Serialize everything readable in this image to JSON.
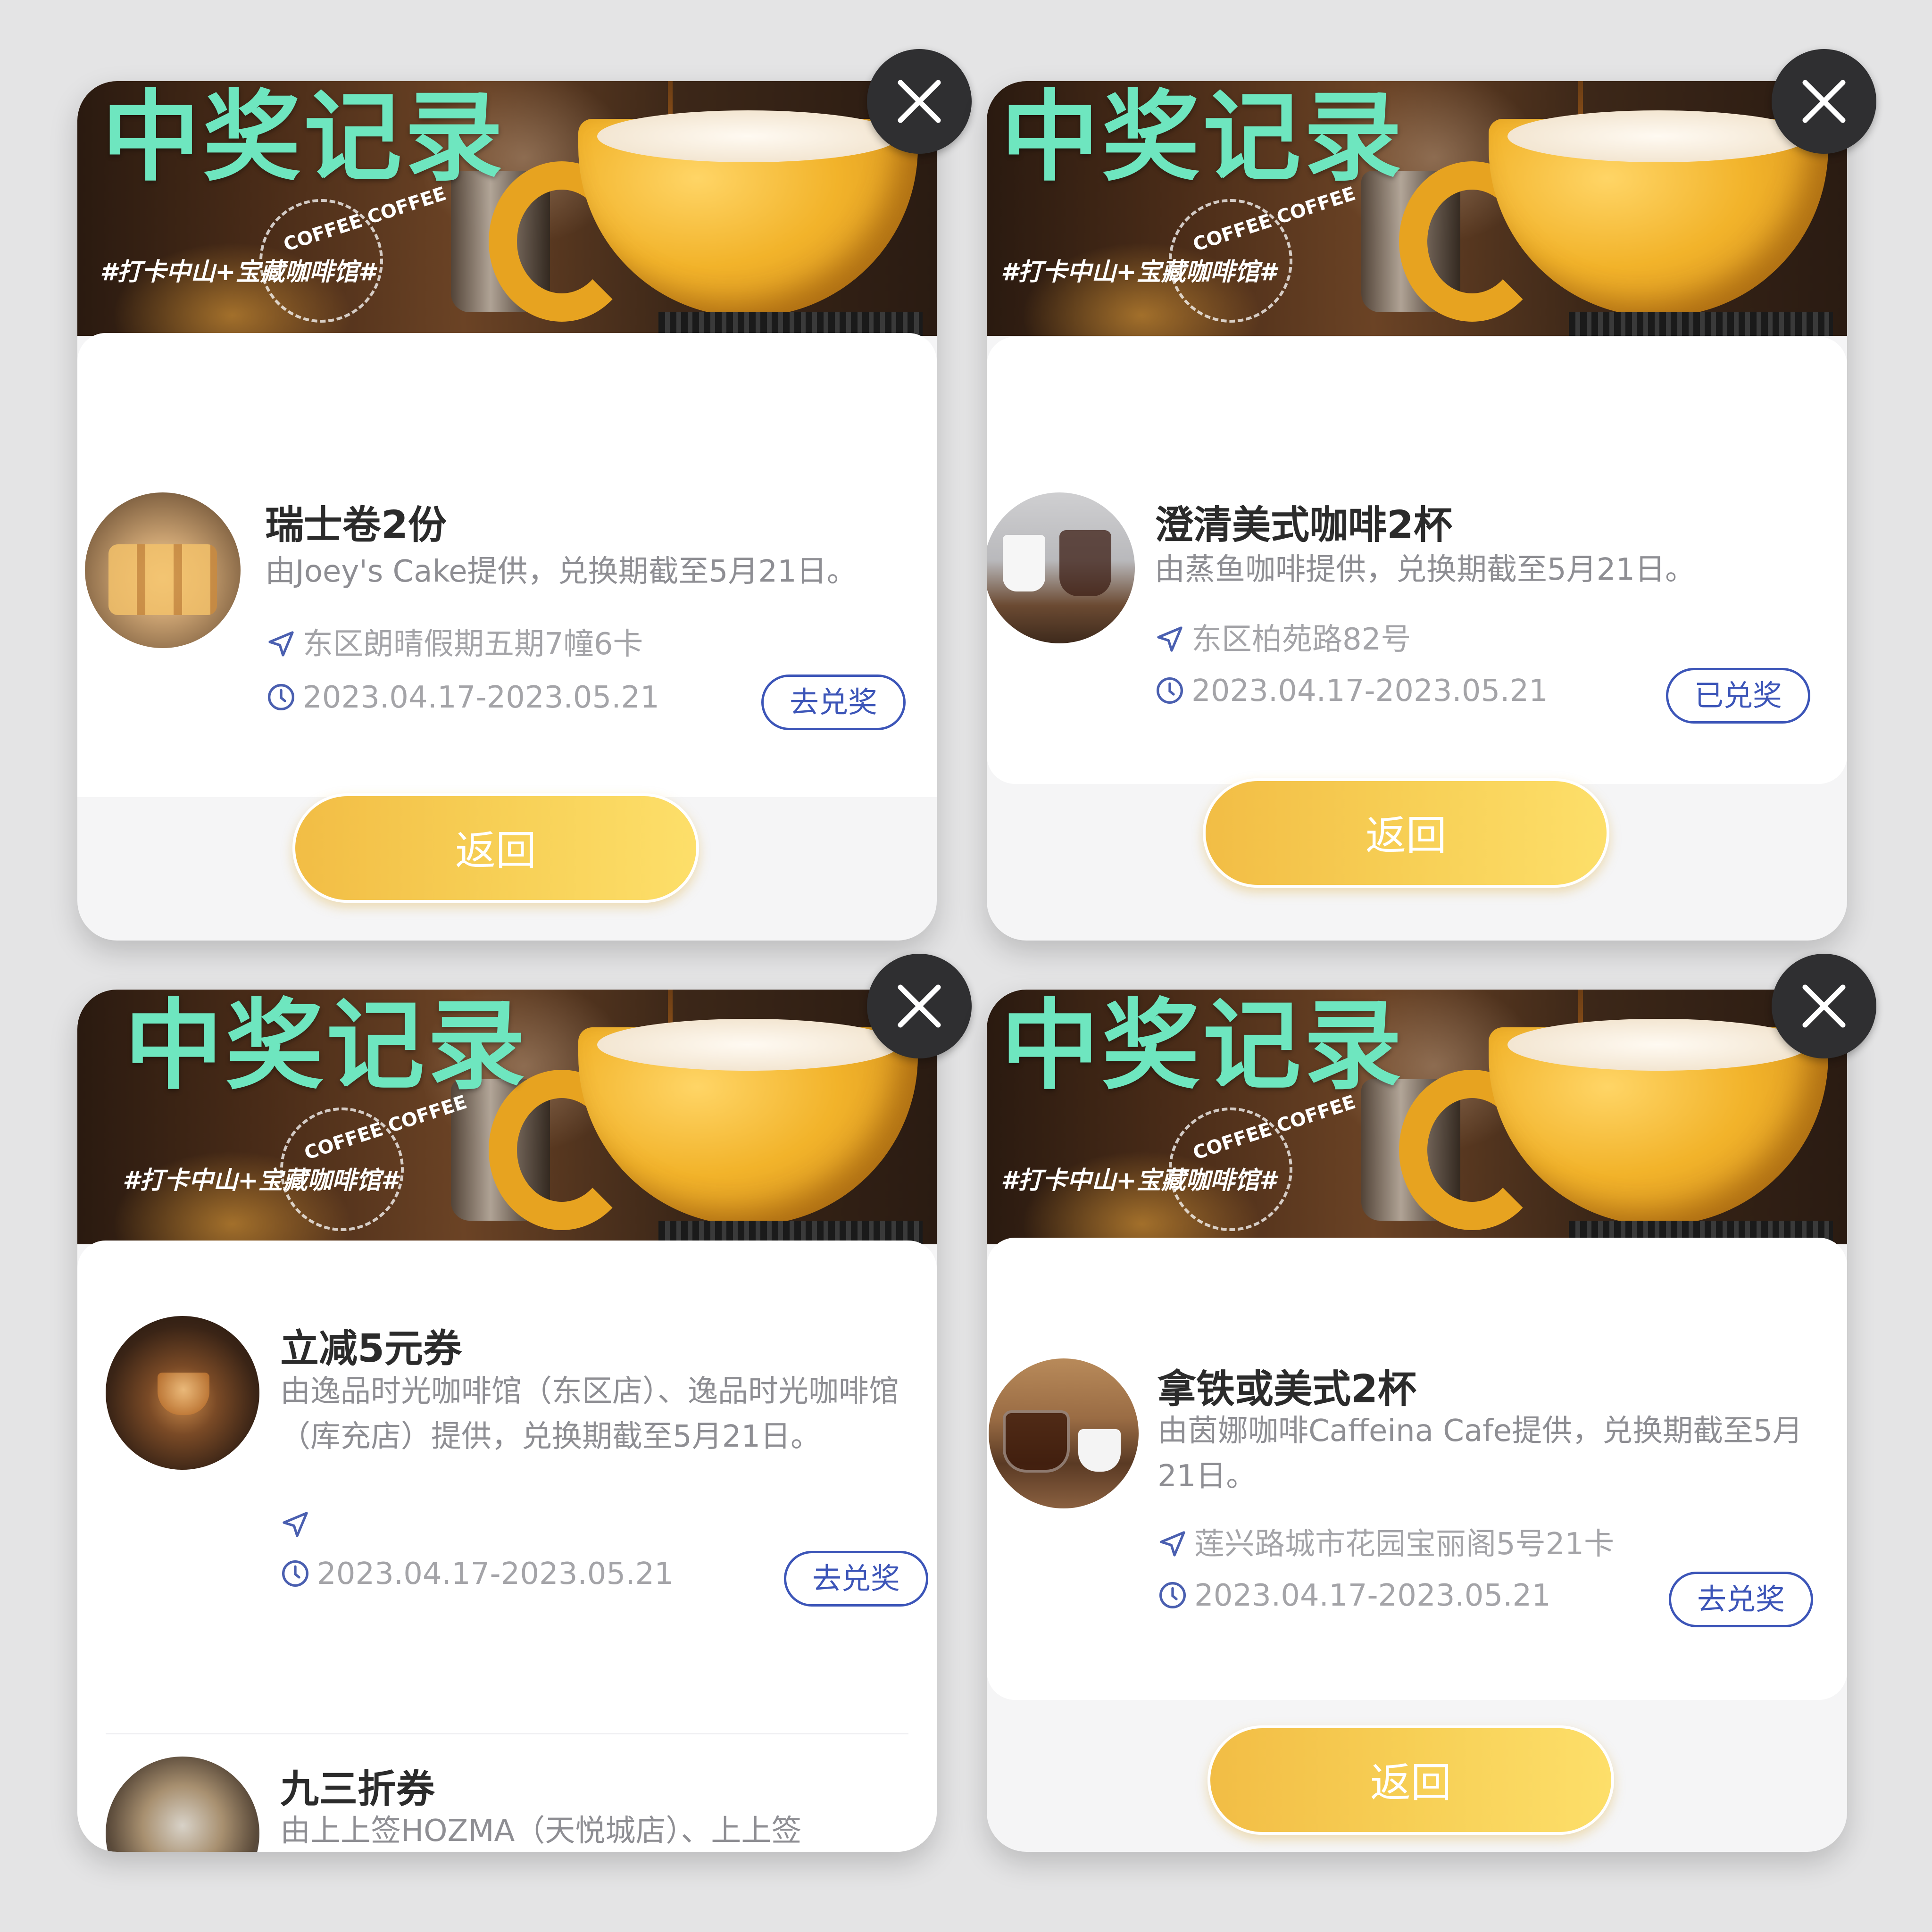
{
  "banner": {
    "title": "中奖记录",
    "hashtag": "#打卡中山+宝藏咖啡馆#",
    "ring_text": "COFFEE COFFEE"
  },
  "panels": [
    {
      "items": [
        {
          "title": "瑞士卷2份",
          "desc": "由Joey's Cake提供，兑换期截至5月21日。",
          "address": "东区朗晴假期五期7幢6卡",
          "date": "2023.04.17-2023.05.21",
          "action": "去兑奖"
        }
      ],
      "back_label": "返回"
    },
    {
      "items": [
        {
          "title": "澄清美式咖啡2杯",
          "desc": "由蒸鱼咖啡提供，兑换期截至5月21日。",
          "address": "东区柏苑路82号",
          "date": "2023.04.17-2023.05.21",
          "action": "已兑奖"
        }
      ],
      "back_label": "返回"
    },
    {
      "items": [
        {
          "title": "立减5元券",
          "desc": "由逸品时光咖啡馆（东区店）、逸品时光咖啡馆（库充店）提供，兑换期截至5月21日。",
          "address": "",
          "date": "2023.04.17-2023.05.21",
          "action": "去兑奖"
        },
        {
          "title": "九三折券",
          "desc": "由上上签HOZMA（天悦城店）、上上签"
        }
      ]
    },
    {
      "items": [
        {
          "title": "拿铁或美式2杯",
          "desc": "由茵娜咖啡Caffeina Cafe提供，兑换期截至5月21日。",
          "address": "莲兴路城市花园宝丽阁5号21卡",
          "date": "2023.04.17-2023.05.21",
          "action": "去兑奖"
        }
      ],
      "back_label": "返回"
    }
  ],
  "colors": {
    "title_green": "#6ee6bf",
    "accent_blue": "#3c55b8",
    "button_gold": "#f7cf55",
    "page_bg": "#e4e4e5"
  }
}
